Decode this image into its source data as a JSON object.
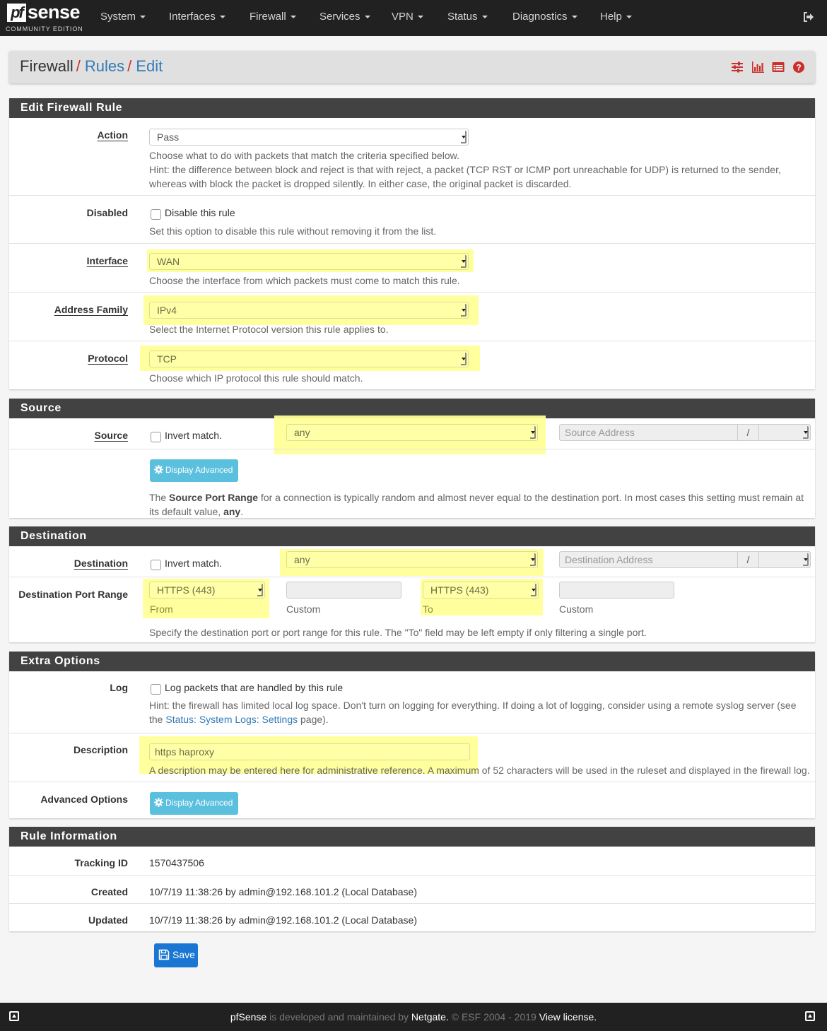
{
  "navbar": {
    "logo_pf": "pf",
    "logo_sense": "sense",
    "logo_edition": "COMMUNITY EDITION",
    "menu": [
      {
        "label": "System"
      },
      {
        "label": "Interfaces"
      },
      {
        "label": "Firewall"
      },
      {
        "label": "Services"
      },
      {
        "label": "VPN"
      },
      {
        "label": "Status"
      },
      {
        "label": "Diagnostics"
      },
      {
        "label": "Help"
      }
    ],
    "logout_icon": "sign-out-icon"
  },
  "breadcrumb": {
    "items": [
      "Firewall",
      "Rules",
      "Edit"
    ],
    "separator": "/",
    "icons": [
      "sliders-icon",
      "bar-chart-icon",
      "list-table-icon",
      "question-circle-icon"
    ]
  },
  "colors": {
    "accent_red": "#c9302c",
    "link_blue": "#337ab7",
    "highlight_yellow": "#ffff99",
    "info_button": "#5bc0de",
    "primary_button": "#1976d2",
    "panel_heading": "#424242"
  },
  "edit_rule": {
    "heading": "Edit Firewall Rule",
    "action": {
      "label": "Action",
      "value": "Pass",
      "help1": "Choose what to do with packets that match the criteria specified below.",
      "help2": "Hint: the difference between block and reject is that with reject, a packet (TCP RST or ICMP port unreachable for UDP) is returned to the sender, whereas with block the packet is dropped silently. In either case, the original packet is discarded."
    },
    "disabled": {
      "label": "Disabled",
      "checkbox_label": "Disable this rule",
      "checked": false,
      "help": "Set this option to disable this rule without removing it from the list."
    },
    "interface": {
      "label": "Interface",
      "value": "WAN",
      "help": "Choose the interface from which packets must come to match this rule."
    },
    "address_family": {
      "label": "Address Family",
      "value": "IPv4",
      "help": "Select the Internet Protocol version this rule applies to."
    },
    "protocol": {
      "label": "Protocol",
      "value": "TCP",
      "help": "Choose which IP protocol this rule should match."
    }
  },
  "source": {
    "heading": "Source",
    "label": "Source",
    "invert_label": "Invert match.",
    "invert_checked": false,
    "type_value": "any",
    "address_placeholder": "Source Address",
    "slash": "/",
    "advanced_button": "Display Advanced",
    "help_pre": "The ",
    "help_bold": "Source Port Range",
    "help_mid": " for a connection is typically random and almost never equal to the destination port. In most cases this setting must remain at its default value, ",
    "help_bold2": "any",
    "help_post": "."
  },
  "destination": {
    "heading": "Destination",
    "label": "Destination",
    "invert_label": "Invert match.",
    "invert_checked": false,
    "type_value": "any",
    "address_placeholder": "Destination Address",
    "slash": "/",
    "port_range_label": "Destination Port Range",
    "from_value": "HTTPS (443)",
    "from_label": "From",
    "from_custom_value": "",
    "from_custom_label": "Custom",
    "to_value": "HTTPS (443)",
    "to_label": "To",
    "to_custom_value": "",
    "to_custom_label": "Custom",
    "help": "Specify the destination port or port range for this rule. The \"To\" field may be left empty if only filtering a single port."
  },
  "extra": {
    "heading": "Extra Options",
    "log": {
      "label": "Log",
      "checkbox_label": "Log packets that are handled by this rule",
      "checked": false,
      "help_pre": "Hint: the firewall has limited local log space. Don't turn on logging for everything. If doing a lot of logging, consider using a remote syslog server (see the ",
      "help_link": "Status: System Logs: Settings",
      "help_post": " page)."
    },
    "description": {
      "label": "Description",
      "value": "https haproxy",
      "help": "A description may be entered here for administrative reference. A maximum of 52 characters will be used in the ruleset and displayed in the firewall log."
    },
    "advanced": {
      "label": "Advanced Options",
      "button": "Display Advanced"
    }
  },
  "rule_info": {
    "heading": "Rule Information",
    "tracking_label": "Tracking ID",
    "tracking_value": "1570437506",
    "created_label": "Created",
    "created_value": "10/7/19 11:38:26 by admin@192.168.101.2 (Local Database)",
    "updated_label": "Updated",
    "updated_value": "10/7/19 11:38:26 by admin@192.168.101.2 (Local Database)"
  },
  "save_button": "Save",
  "footer": {
    "brand": "pfSense",
    "text1": " is developed and maintained by ",
    "company": "Netgate.",
    "text2": " © ESF 2004 - 2019 ",
    "license": "View license."
  }
}
